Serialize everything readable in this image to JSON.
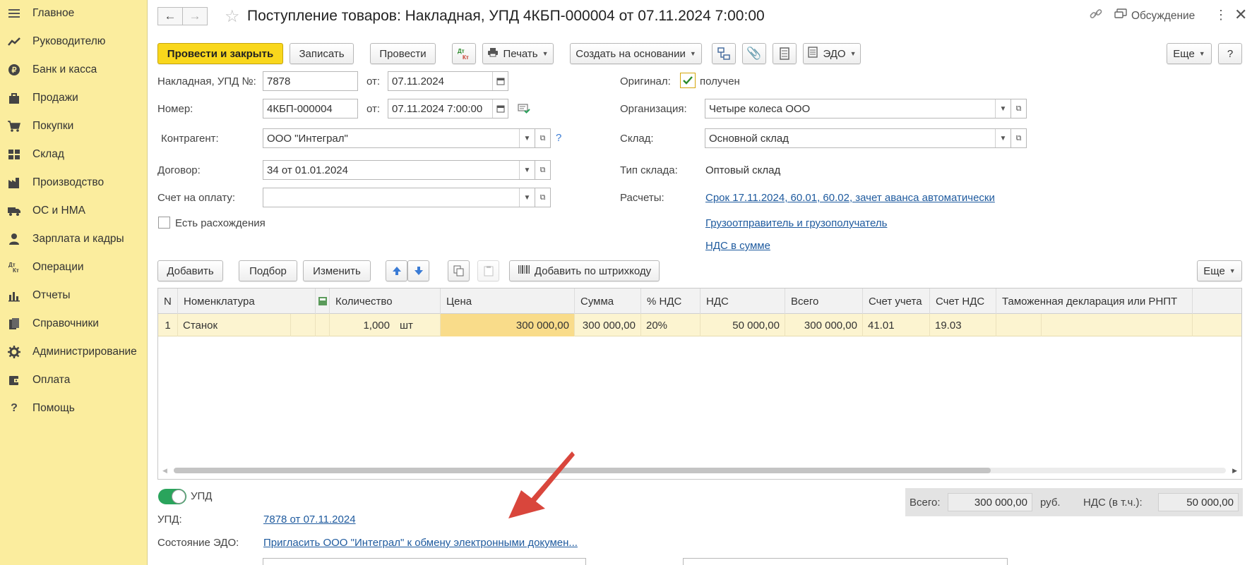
{
  "sidebar": {
    "items": [
      {
        "label": "Главное",
        "icon": "menu-icon"
      },
      {
        "label": "Руководителю",
        "icon": "trend-icon"
      },
      {
        "label": "Банк и касса",
        "icon": "coin-icon"
      },
      {
        "label": "Продажи",
        "icon": "bag-icon"
      },
      {
        "label": "Покупки",
        "icon": "cart-icon"
      },
      {
        "label": "Склад",
        "icon": "warehouse-icon"
      },
      {
        "label": "Производство",
        "icon": "factory-icon"
      },
      {
        "label": "ОС и НМА",
        "icon": "truck-icon"
      },
      {
        "label": "Зарплата и кадры",
        "icon": "person-icon"
      },
      {
        "label": "Операции",
        "icon": "dt-kt-icon"
      },
      {
        "label": "Отчеты",
        "icon": "bar-chart-icon"
      },
      {
        "label": "Справочники",
        "icon": "books-icon"
      },
      {
        "label": "Администрирование",
        "icon": "gear-icon"
      },
      {
        "label": "Оплата",
        "icon": "wallet-icon"
      },
      {
        "label": "Помощь",
        "icon": "help-icon"
      }
    ]
  },
  "header": {
    "title": "Поступление товаров: Накладная, УПД 4КБП-000004 от 07.11.2024 7:00:00",
    "discussion": "Обсуждение"
  },
  "toolbar": {
    "post_close": "Провести и закрыть",
    "save": "Записать",
    "post": "Провести",
    "print": "Печать",
    "create_based": "Создать на основании",
    "edo": "ЭДО",
    "more": "Еще",
    "help": "?"
  },
  "form": {
    "invoice_label": "Накладная, УПД №:",
    "invoice_no": "7878",
    "from_label": "от:",
    "invoice_date": "07.11.2024",
    "number_label": "Номер:",
    "number": "4КБП-000004",
    "number_datetime": "07.11.2024  7:00:00",
    "counterparty_label": "Контрагент:",
    "counterparty": "ООО \"Интеграл\"",
    "contract_label": "Договор:",
    "contract": "34 от 01.01.2024",
    "payment_invoice_label": "Счет на оплату:",
    "payment_invoice": "",
    "discrepancy_label": "Есть расхождения",
    "original_label": "Оригинал:",
    "original_value": "получен",
    "org_label": "Организация:",
    "org": "Четыре колеса ООО",
    "warehouse_label": "Склад:",
    "warehouse": "Основной склад",
    "warehouse_type_label": "Тип склада:",
    "warehouse_type": "Оптовый склад",
    "settlements_label": "Расчеты:",
    "settlements_link": "Срок 17.11.2024, 60.01, 60.02, зачет аванса автоматически",
    "shipper_link": "Грузоотправитель и грузополучатель",
    "vat_link": "НДС в сумме"
  },
  "table_toolbar": {
    "add": "Добавить",
    "pick": "Подбор",
    "edit": "Изменить",
    "add_barcode": "Добавить по штрихкоду",
    "more": "Еще"
  },
  "table": {
    "columns": [
      "N",
      "Номенклатура",
      "Количество",
      "Цена",
      "Сумма",
      "% НДС",
      "НДС",
      "Всего",
      "Счет учета",
      "Счет НДС",
      "Таможенная декларация или РНПТ"
    ],
    "rows": [
      {
        "n": "1",
        "item": "Станок",
        "qty": "1,000",
        "unit": "шт",
        "price": "300 000,00",
        "sum": "300 000,00",
        "vat_rate": "20%",
        "vat": "50 000,00",
        "total": "300 000,00",
        "account": "41.01",
        "vat_account": "19.03",
        "customs": ""
      }
    ]
  },
  "footer": {
    "upd_toggle_label": "УПД",
    "upd_label": "УПД:",
    "upd_link": "7878 от 07.11.2024",
    "edo_state_label": "Состояние ЭДО:",
    "edo_state_link": "Пригласить ООО \"Интеграл\" к обмену электронными докумен...",
    "total_label": "Всего:",
    "total_value": "300 000,00",
    "currency": "руб.",
    "vat_incl_label": "НДС (в т.ч.):",
    "vat_incl_value": "50 000,00"
  },
  "colors": {
    "sidebar": "#fbed9e",
    "primary_button": "#f9d71c",
    "link": "#1e5a9e",
    "row_highlight": "#fcf4d0",
    "arrow": "#d9463c",
    "toggle_on": "#2aa45c"
  }
}
